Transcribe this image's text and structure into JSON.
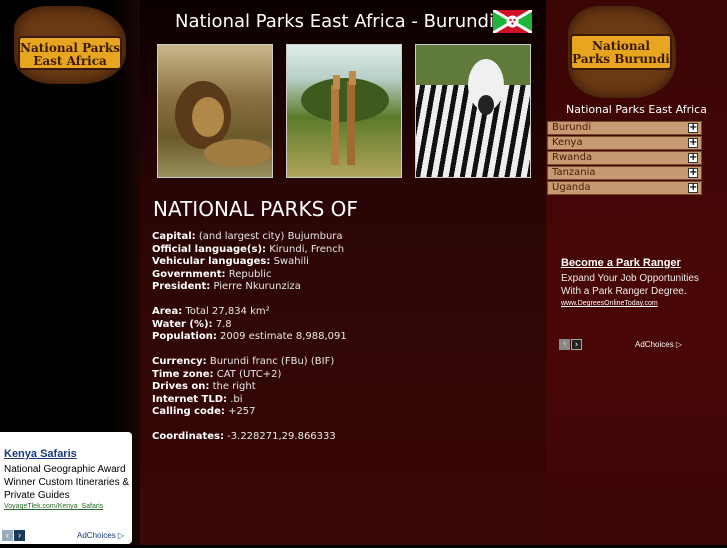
{
  "header": {
    "title": "National Parks East Africa - Burundi",
    "logo_left_text": "National Parks East Africa",
    "logo_right_text": "National Parks Burundi",
    "flag_icon": "burundi-flag-icon"
  },
  "photos": [
    "lion",
    "giraffes",
    "zebra"
  ],
  "section_heading": "NATIONAL PARKS OF",
  "facts": {
    "capital": {
      "label": "Capital:",
      "value": "(and largest city) Bujumbura"
    },
    "official_languages": {
      "label": "Official language(s):",
      "value": "Kirundi, French"
    },
    "vehicular_languages": {
      "label": "Vehicular languages:",
      "value": "Swahili"
    },
    "government": {
      "label": "Government:",
      "value": "Republic"
    },
    "president": {
      "label": "President:",
      "value": "Pierre Nkurunziza"
    },
    "area": {
      "label": "Area:",
      "value": "Total 27,834 km²"
    },
    "water": {
      "label": "Water (%):",
      "value": "7.8"
    },
    "population": {
      "label": "Population:",
      "value": "2009 estimate 8,988,091"
    },
    "currency": {
      "label": "Currency:",
      "value": "Burundi franc (FBu) (BIF)"
    },
    "time_zone": {
      "label": "Time zone:",
      "value": "CAT (UTC+2)"
    },
    "drives_on": {
      "label": "Drives on:",
      "value": "the right"
    },
    "internet_tld": {
      "label": "Internet TLD:",
      "value": ".bi"
    },
    "calling_code": {
      "label": "Calling code:",
      "value": "+257"
    },
    "coordinates": {
      "label": "Coordinates:",
      "value": "-3.228271,29.866333"
    }
  },
  "right": {
    "heading": "National Parks East Africa",
    "menu": [
      {
        "label": "Burundi"
      },
      {
        "label": "Kenya"
      },
      {
        "label": "Rwanda"
      },
      {
        "label": "Tanzania"
      },
      {
        "label": "Uganda"
      }
    ]
  },
  "ad_right": {
    "title": "Become a Park Ranger",
    "body": "Expand Your Job Opportunities With a Park Ranger Degree.",
    "url": "www.DegreesOnlineToday.com",
    "choices": "AdChoices"
  },
  "ad_left": {
    "title": "Kenya Safaris",
    "body": "National Geographic Award Winner Custom Itineraries & Private Guides",
    "url": "VoyageTlek.com/Kenya_Safaris",
    "choices": "AdChoices"
  },
  "colors": {
    "background": "#000000",
    "center_panel": "#3a0707",
    "right_panel": "#4a0606",
    "menu_item": "#c69a72",
    "logo_badge": "#e8a51f"
  }
}
